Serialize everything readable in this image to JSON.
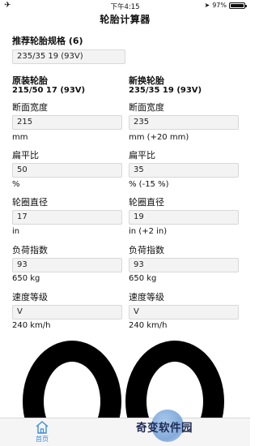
{
  "status_bar": {
    "time": "下午4:15",
    "battery": "97%",
    "battery_level": 0.97
  },
  "nav": {
    "title": "轮胎计算器"
  },
  "recommend": {
    "label": "推荐轮胎规格 (6)",
    "value": "235/35 19 (93V)"
  },
  "original": {
    "title": "原装轮胎",
    "spec": "215/50 17 (93V)",
    "section_width": {
      "label": "断面宽度",
      "value": "215",
      "note": "mm"
    },
    "aspect_ratio": {
      "label": "扁平比",
      "value": "50",
      "note": "%"
    },
    "rim_diameter": {
      "label": "轮圈直径",
      "value": "17",
      "note": "in"
    },
    "load_index": {
      "label": "负荷指数",
      "value": "93",
      "note": "650 kg"
    },
    "speed_rating": {
      "label": "速度等级",
      "value": "V",
      "note": "240 km/h"
    }
  },
  "replacement": {
    "title": "新换轮胎",
    "spec": "235/35 19 (93V)",
    "section_width": {
      "label": "断面宽度",
      "value": "235",
      "note": "mm (+20 mm)"
    },
    "aspect_ratio": {
      "label": "扁平比",
      "value": "35",
      "note": "% (-15 %)"
    },
    "rim_diameter": {
      "label": "轮圈直径",
      "value": "19",
      "note": "in (+2 in)"
    },
    "load_index": {
      "label": "负荷指数",
      "value": "93",
      "note": "650 kg"
    },
    "speed_rating": {
      "label": "速度等级",
      "value": "V",
      "note": "240 km/h"
    }
  },
  "tab_bar": {
    "home_label": "首页"
  },
  "watermark": {
    "text": "奇变软件园"
  },
  "colors": {
    "accent": "#3c8cd9",
    "field_bg": "#f3f3f3"
  },
  "icons": {
    "status_left": "airplane-icon",
    "location": "location-arrow-icon",
    "tab_home": "home-icon"
  }
}
